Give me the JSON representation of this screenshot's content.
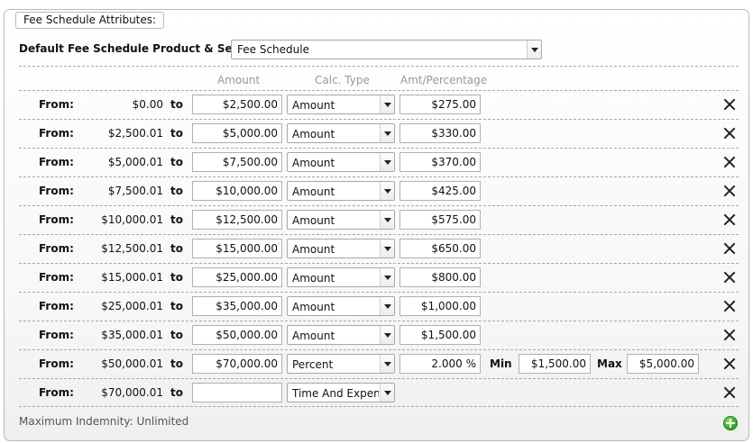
{
  "panel": {
    "legend": "Fee Schedule Attributes:",
    "default_product_label": "Default Fee Schedule Product & Service:",
    "default_product_value": "Fee Schedule",
    "column_headers": {
      "amount": "Amount",
      "calc_type": "Calc. Type",
      "amount_percentage": "Amt/Percentage"
    },
    "labels": {
      "from": "From:",
      "to": "to",
      "min": "Min",
      "max": "Max"
    },
    "rows": [
      {
        "from": "$0.00",
        "to": "$2,500.00",
        "calc_type": "Amount",
        "amount_percentage": "$275.00",
        "min": "",
        "max": ""
      },
      {
        "from": "$2,500.01",
        "to": "$5,000.00",
        "calc_type": "Amount",
        "amount_percentage": "$330.00",
        "min": "",
        "max": ""
      },
      {
        "from": "$5,000.01",
        "to": "$7,500.00",
        "calc_type": "Amount",
        "amount_percentage": "$370.00",
        "min": "",
        "max": ""
      },
      {
        "from": "$7,500.01",
        "to": "$10,000.00",
        "calc_type": "Amount",
        "amount_percentage": "$425.00",
        "min": "",
        "max": ""
      },
      {
        "from": "$10,000.01",
        "to": "$12,500.00",
        "calc_type": "Amount",
        "amount_percentage": "$575.00",
        "min": "",
        "max": ""
      },
      {
        "from": "$12,500.01",
        "to": "$15,000.00",
        "calc_type": "Amount",
        "amount_percentage": "$650.00",
        "min": "",
        "max": ""
      },
      {
        "from": "$15,000.01",
        "to": "$25,000.00",
        "calc_type": "Amount",
        "amount_percentage": "$800.00",
        "min": "",
        "max": ""
      },
      {
        "from": "$25,000.01",
        "to": "$35,000.00",
        "calc_type": "Amount",
        "amount_percentage": "$1,000.00",
        "min": "",
        "max": ""
      },
      {
        "from": "$35,000.01",
        "to": "$50,000.00",
        "calc_type": "Amount",
        "amount_percentage": "$1,500.00",
        "min": "",
        "max": ""
      },
      {
        "from": "$50,000.01",
        "to": "$70,000.00",
        "calc_type": "Percent",
        "amount_percentage": "2.000 %",
        "min": "$1,500.00",
        "max": "$5,000.00"
      },
      {
        "from": "$70,000.01",
        "to": "",
        "calc_type": "Time And Expense",
        "amount_percentage": "",
        "min": "",
        "max": ""
      }
    ],
    "max_indemnity": "Maximum Indemnity: Unlimited"
  },
  "icons": {
    "dropdown": "chevron-down-icon",
    "remove": "close-icon",
    "add": "plus-circle-icon"
  },
  "colors": {
    "add_button": "#35a82a",
    "border": "#b9b9b9",
    "header_text": "#999999"
  }
}
